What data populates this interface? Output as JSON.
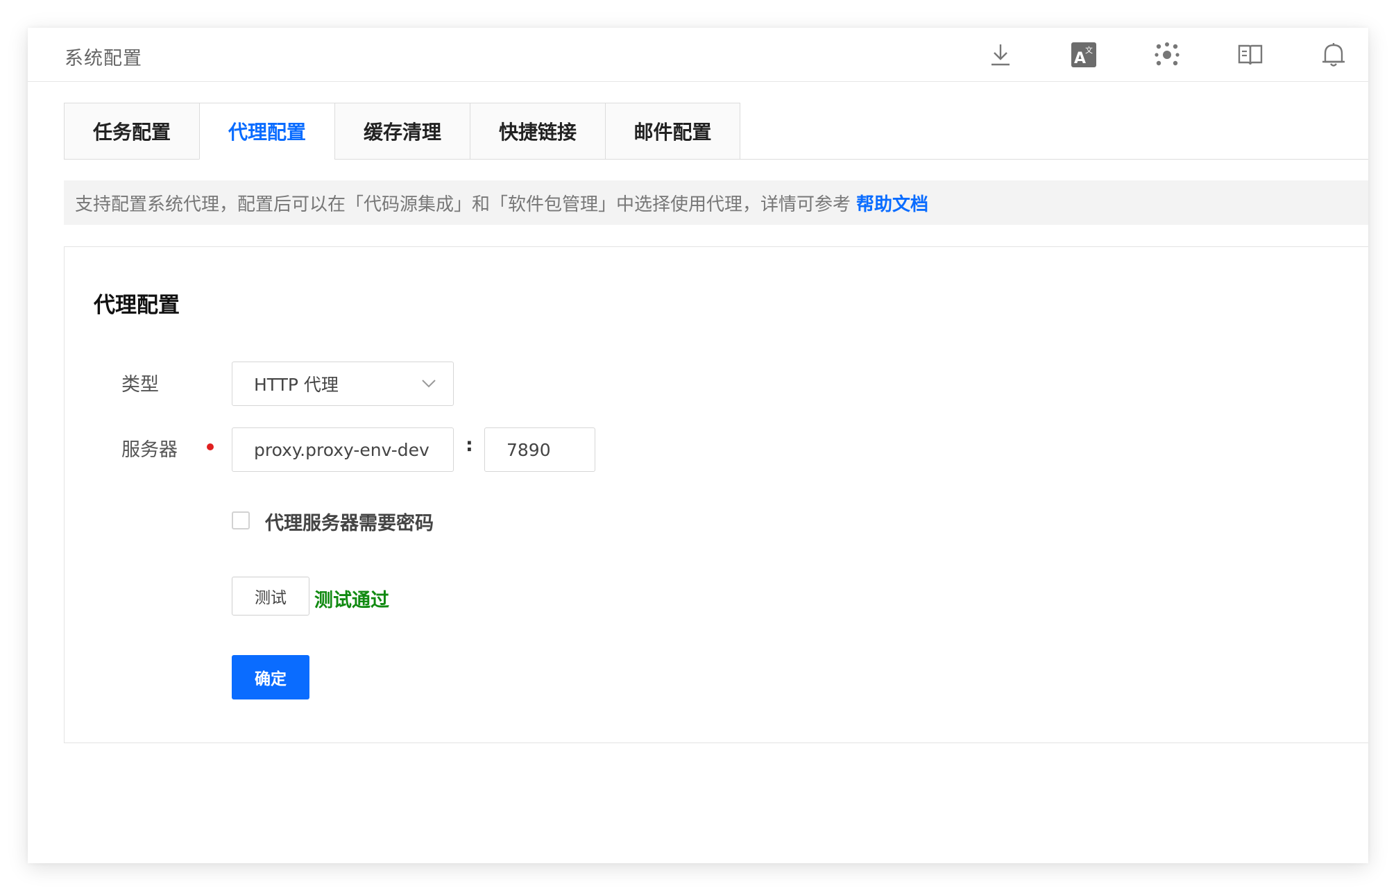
{
  "header": {
    "title": "系统配置",
    "icons": [
      "download-icon",
      "translate-icon",
      "dots-cluster-icon",
      "book-icon",
      "bell-icon"
    ]
  },
  "tabs": [
    {
      "label": "任务配置",
      "active": false
    },
    {
      "label": "代理配置",
      "active": true
    },
    {
      "label": "缓存清理",
      "active": false
    },
    {
      "label": "快捷链接",
      "active": false
    },
    {
      "label": "邮件配置",
      "active": false
    }
  ],
  "tip": {
    "text": "支持配置系统代理，配置后可以在「代码源集成」和「软件包管理」中选择使用代理，详情可参考",
    "link": "帮助文档"
  },
  "panel": {
    "title": "代理配置",
    "type_label": "类型",
    "type_value": "HTTP 代理",
    "server_label": "服务器",
    "server_host": "proxy.proxy-env-dev",
    "colon": ":",
    "server_port": "7890",
    "auth_checkbox_label": "代理服务器需要密码",
    "test_button": "测试",
    "test_status": "测试通过",
    "confirm_button": "确定"
  },
  "colors": {
    "accent": "#0a6cff",
    "success": "#118a11",
    "required": "#e02020"
  }
}
